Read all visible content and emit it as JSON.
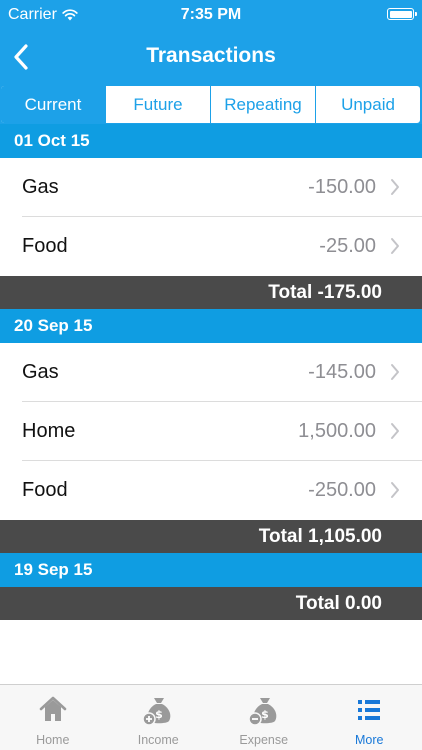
{
  "status_bar": {
    "carrier": "Carrier",
    "time": "7:35 PM"
  },
  "nav": {
    "title": "Transactions",
    "back_icon": "chevron-left-icon"
  },
  "segments": [
    {
      "label": "Current",
      "active": true
    },
    {
      "label": "Future",
      "active": false
    },
    {
      "label": "Repeating",
      "active": false
    },
    {
      "label": "Unpaid",
      "active": false
    }
  ],
  "groups": [
    {
      "date": "01 Oct 15",
      "items": [
        {
          "name": "Gas",
          "amount": "-150.00"
        },
        {
          "name": "Food",
          "amount": "-25.00"
        }
      ],
      "total": "Total -175.00"
    },
    {
      "date": "20 Sep 15",
      "items": [
        {
          "name": "Gas",
          "amount": "-145.00"
        },
        {
          "name": "Home",
          "amount": "1,500.00"
        },
        {
          "name": "Food",
          "amount": "-250.00"
        }
      ],
      "total": "Total 1,105.00"
    },
    {
      "date": "19 Sep 15",
      "items": [],
      "total": "Total 0.00"
    }
  ],
  "tabbar": [
    {
      "label": "Home",
      "icon": "home-icon",
      "active": false
    },
    {
      "label": "Income",
      "icon": "money-bag-plus-icon",
      "active": false
    },
    {
      "label": "Expense",
      "icon": "money-bag-minus-icon",
      "active": false
    },
    {
      "label": "More",
      "icon": "list-icon",
      "active": true
    }
  ],
  "colors": {
    "accent": "#1da1e8",
    "header": "#0f9de2",
    "total_bar": "#4a4a4a",
    "active_tab": "#1878d8",
    "inactive_tab": "#9a9a9a"
  }
}
